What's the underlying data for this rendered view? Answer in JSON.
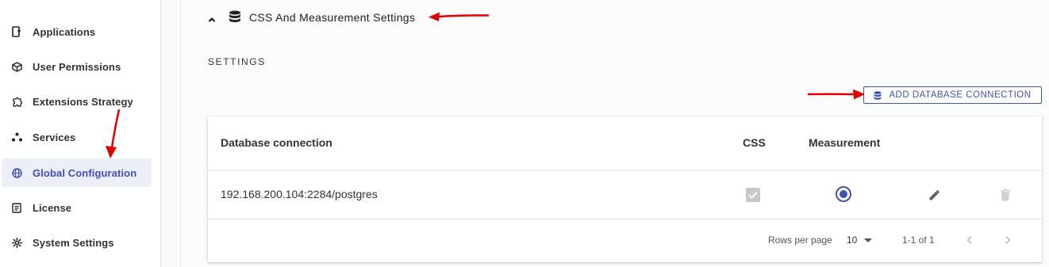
{
  "sidebar": {
    "items": [
      {
        "label": "Applications",
        "icon": "applications-icon",
        "active": false
      },
      {
        "label": "User Permissions",
        "icon": "cube-icon",
        "active": false
      },
      {
        "label": "Extensions Strategy",
        "icon": "puzzle-icon",
        "active": false
      },
      {
        "label": "Services",
        "icon": "services-icon",
        "active": false
      },
      {
        "label": "Global Configuration",
        "icon": "globe-icon",
        "active": true
      },
      {
        "label": "License",
        "icon": "document-icon",
        "active": false
      },
      {
        "label": "System Settings",
        "icon": "gear-icon",
        "active": false
      }
    ]
  },
  "section": {
    "title": "CSS And Measurement Settings",
    "subtitle": "SETTINGS"
  },
  "toolbar": {
    "add_label": "ADD DATABASE CONNECTION"
  },
  "table": {
    "headers": {
      "connection": "Database connection",
      "css": "CSS",
      "measurement": "Measurement"
    },
    "rows": [
      {
        "connection": "192.168.200.104:2284/postgres",
        "css": true,
        "measurement": true
      }
    ]
  },
  "pagination": {
    "rows_per_page_label": "Rows per page",
    "rows_per_page": "10",
    "range": "1-1 of 1"
  },
  "colors": {
    "accent": "#3f51b5",
    "annotation": "#e00000",
    "active_bg": "#eceef8"
  }
}
